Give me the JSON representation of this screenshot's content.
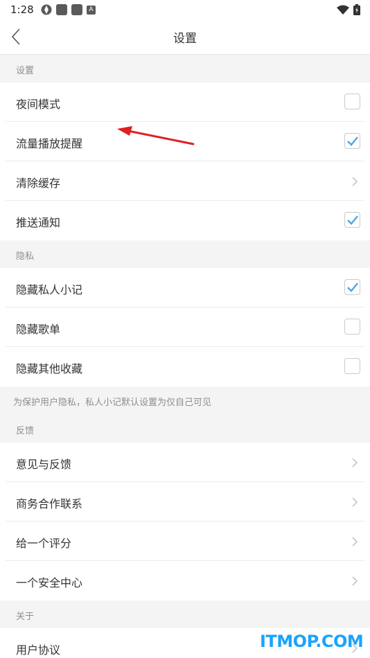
{
  "status_bar": {
    "time": "1:28",
    "badge_letter": "A"
  },
  "header": {
    "title": "设置"
  },
  "sections": {
    "settings": {
      "title": "设置",
      "items": [
        {
          "label": "夜间模式",
          "control": "checkbox",
          "checked": false
        },
        {
          "label": "流量播放提醒",
          "control": "checkbox",
          "checked": true
        },
        {
          "label": "清除缓存",
          "control": "chevron"
        },
        {
          "label": "推送通知",
          "control": "checkbox",
          "checked": true
        }
      ]
    },
    "privacy": {
      "title": "隐私",
      "items": [
        {
          "label": "隐藏私人小记",
          "control": "checkbox",
          "checked": true
        },
        {
          "label": "隐藏歌单",
          "control": "checkbox",
          "checked": false
        },
        {
          "label": "隐藏其他收藏",
          "control": "checkbox",
          "checked": false
        }
      ],
      "note": "为保护用户隐私，私人小记默认设置为仅自己可见"
    },
    "feedback": {
      "title": "反馈",
      "items": [
        {
          "label": "意见与反馈",
          "control": "chevron"
        },
        {
          "label": "商务合作联系",
          "control": "chevron"
        },
        {
          "label": "给一个评分",
          "control": "chevron"
        },
        {
          "label": "一个安全中心",
          "control": "chevron"
        }
      ]
    },
    "about": {
      "title": "关于",
      "items": [
        {
          "label": "用户协议",
          "control": "chevron"
        }
      ]
    }
  },
  "colors": {
    "accent_check": "#4aa8e0",
    "annotation": "#e02020",
    "watermark": "#1aa3ff"
  },
  "watermark": "ITMOP.COM"
}
